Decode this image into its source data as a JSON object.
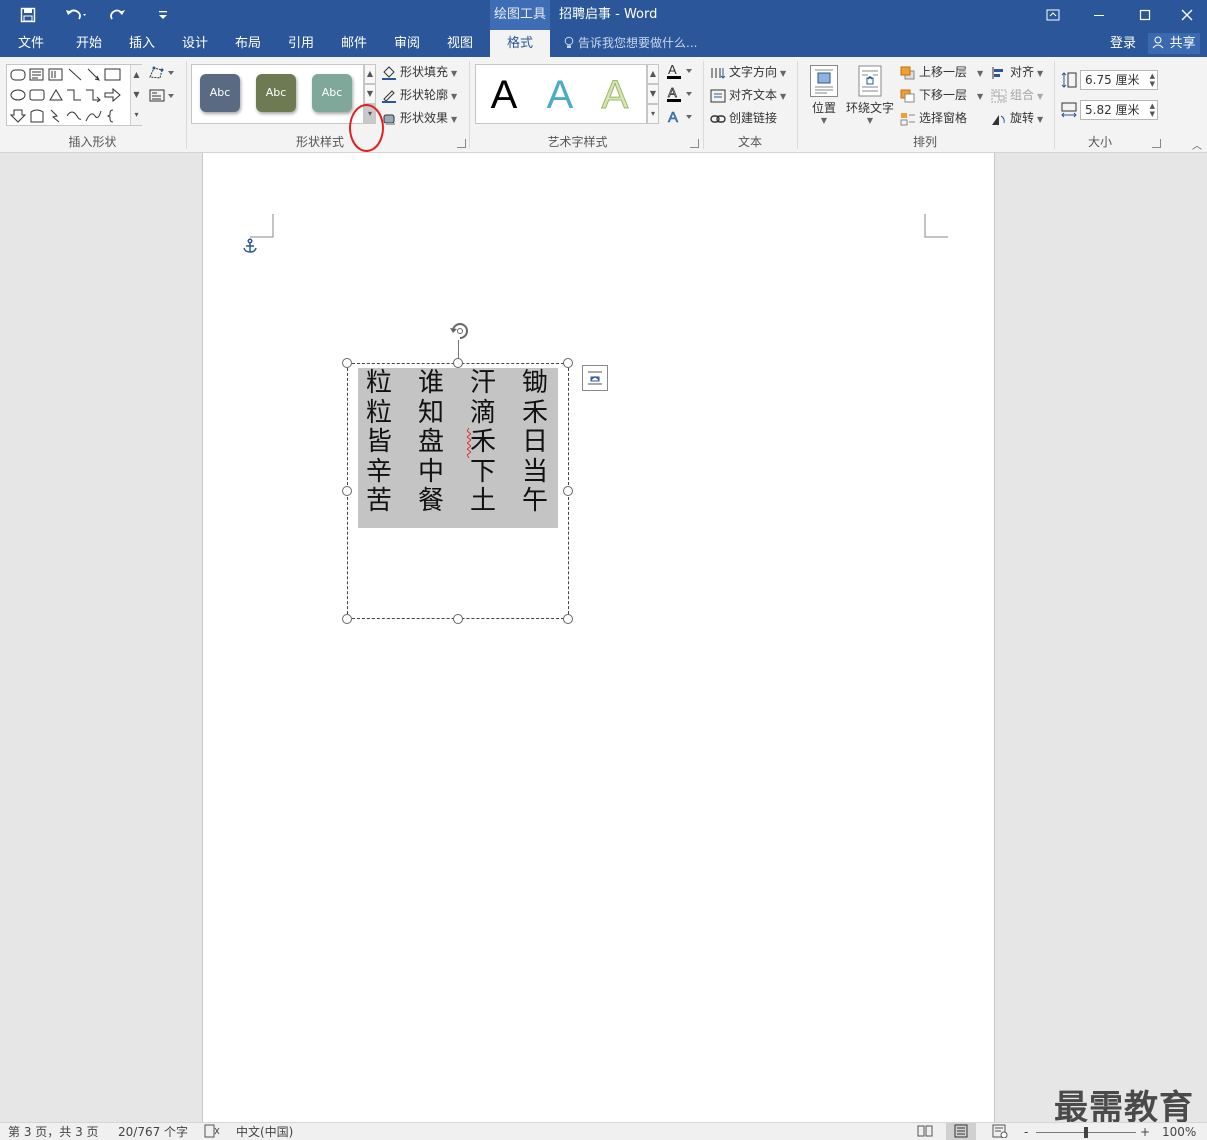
{
  "titlebar": {
    "save_icon": "save-icon",
    "undo_icon": "undo-icon",
    "redo_icon": "redo-icon",
    "customize_icon": "customize-icon",
    "context_tools": "绘图工具",
    "document_title": "招聘启事 - Word",
    "window_buttons": [
      "ribbon-display-icon",
      "minimize-icon",
      "maximize-icon",
      "close-icon"
    ]
  },
  "tabs": {
    "file": "文件",
    "home": "开始",
    "insert": "插入",
    "design": "设计",
    "layout": "布局",
    "references": "引用",
    "mailings": "邮件",
    "review": "审阅",
    "view": "视图",
    "format": "格式",
    "tell_me": "告诉我您想要做什么...",
    "login": "登录",
    "share": "共享"
  },
  "ribbon": {
    "groups": {
      "insert_shapes": "插入形状",
      "shape_styles": "形状样式",
      "wordart_styles": "艺术字样式",
      "text": "文本",
      "arrange": "排列",
      "size": "大小"
    },
    "style_thumbs": [
      {
        "label": "Abc",
        "color": "#5a6a82"
      },
      {
        "label": "Abc",
        "color": "#6e7a52"
      },
      {
        "label": "Abc",
        "color": "#7fa89a"
      }
    ],
    "shape_fill": "形状填充",
    "shape_outline": "形状轮廓",
    "shape_effects": "形状效果",
    "wordart": [
      {
        "label": "A",
        "color": "#000000"
      },
      {
        "label": "A",
        "color": "#4bacc6"
      },
      {
        "label": "A",
        "color": "#d7e4bd"
      }
    ],
    "text_direction": "文字方向",
    "align_text": "对齐文本",
    "create_link": "创建链接",
    "position": "位置",
    "wrap_text": "环绕文字",
    "bring_forward": "上移一层",
    "send_backward": "下移一层",
    "selection_pane": "选择窗格",
    "align": "对齐",
    "group": "组合",
    "rotate": "旋转",
    "height": "6.75 厘米",
    "width": "5.82 厘米"
  },
  "document": {
    "poem_columns": [
      [
        "锄",
        "禾",
        "日",
        "当",
        "午"
      ],
      [
        "汗",
        "滴",
        "禾",
        "下",
        "土"
      ],
      [
        "谁",
        "知",
        "盘",
        "中",
        "餐"
      ],
      [
        "粒",
        "粒",
        "皆",
        "辛",
        "苦"
      ]
    ],
    "anchor_icon": "anchor-icon",
    "layout_options_icon": "layout-options-icon",
    "rotate_handle_icon": "rotate-handle-icon"
  },
  "watermark": "最需教育",
  "statusbar": {
    "page": "第 3 页，共 3 页",
    "words": "20/767 个字",
    "proofing_icon": "proofing-icon",
    "language": "中文(中国)",
    "zoom_minus": "-",
    "zoom_plus": "+",
    "zoom": "100%",
    "zoom_percent": 100
  },
  "colors": {
    "word_blue": "#2b579a",
    "ribbon_bg": "#f3f3f3",
    "textbox_fill": "#c4c4c4",
    "highlight_circle": "#e02020"
  }
}
